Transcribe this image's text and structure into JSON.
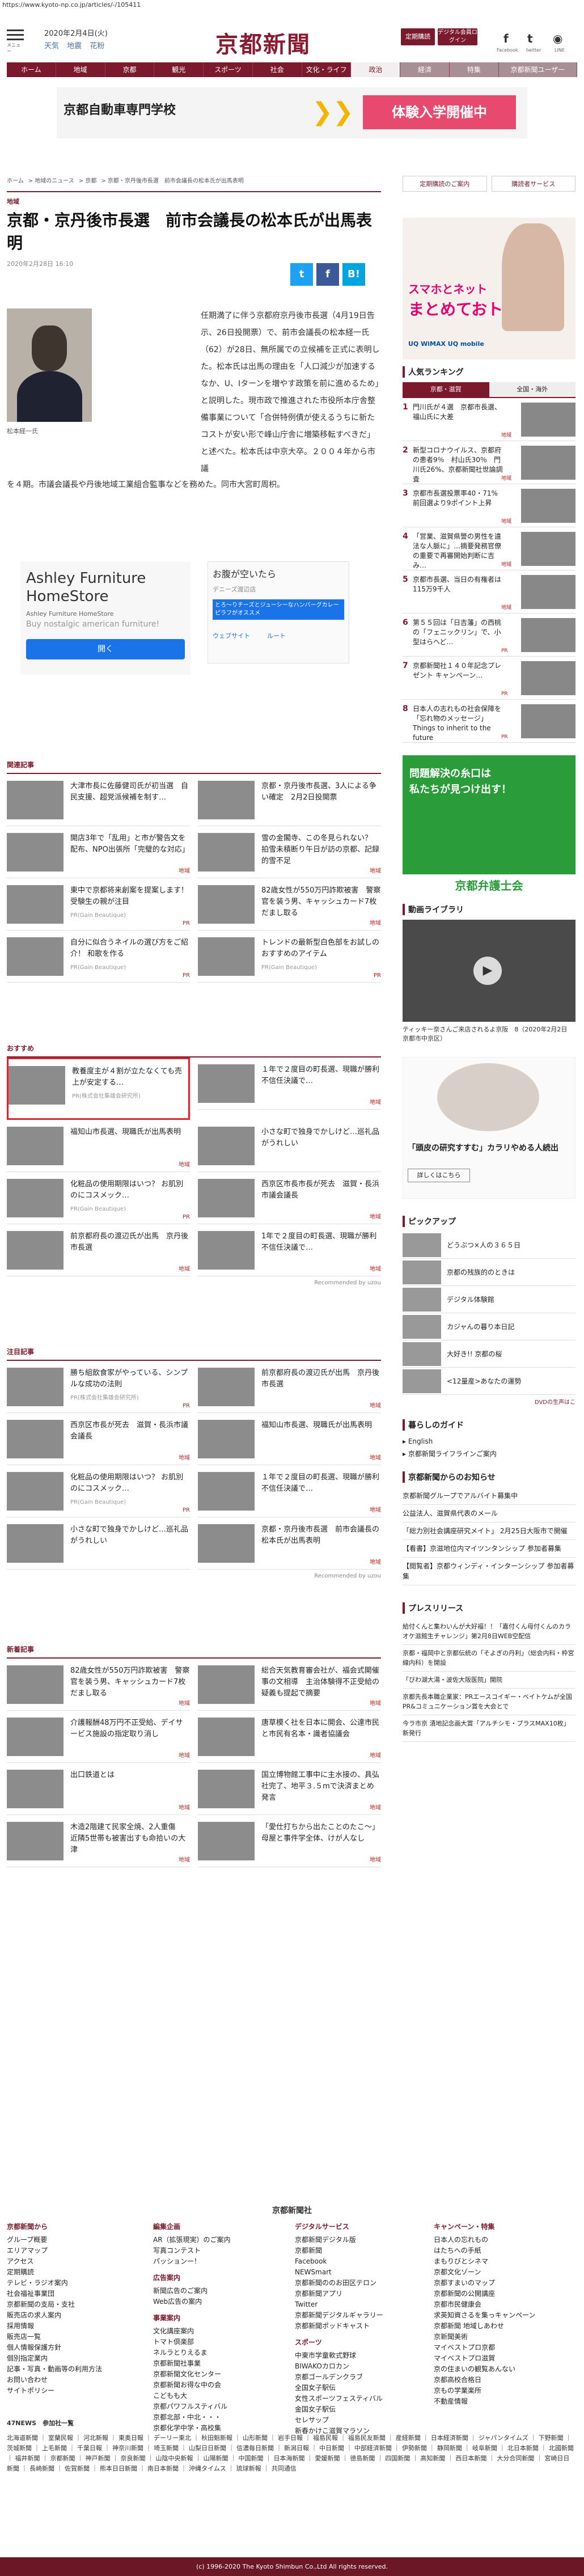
{
  "browser": {
    "url": "https://www.kyoto-np.co.jp/articles/-/105411"
  },
  "header": {
    "menu_label": "メニュー",
    "date": "2020年2月4日(火)",
    "weather": [
      "天気",
      "地震",
      "花粉"
    ],
    "logo": "京都新聞",
    "buttons": [
      "定期購読",
      "デジタル会員ログイン"
    ],
    "sns": [
      {
        "icon": "f",
        "label": "Facebook"
      },
      {
        "icon": "t",
        "label": "twitter"
      },
      {
        "icon": "◉",
        "label": "LINE"
      }
    ]
  },
  "nav": [
    "ホーム",
    "地域",
    "京都",
    "観光",
    "スポーツ",
    "社会",
    "文化・ライフ",
    "政治",
    "経済",
    "特集",
    "京都新聞ユーザー"
  ],
  "ad_top": {
    "left": "京都自動車専門学校",
    "right": "体験入学開催中"
  },
  "breadcrumb": [
    "ホーム",
    "地域のニュース",
    "京都",
    "京都・京丹後市長選　前市会議長の松本氏が出馬表明"
  ],
  "article": {
    "category": "地域",
    "title": "京都・京丹後市長選　前市会議長の松本氏が出馬表明",
    "date": "2020年2月28日 16:10",
    "photo_caption": "松本経一氏",
    "body_right": "任期満了に伴う京都府京丹後市長選（4月19日告示、26日投開票）で、前市会議長の松本経一氏（62）が28日、無所属での立候補を正式に表明した。松本氏は出馬の理由を「人口減少が加速するなか、U、Iターンを増やす政策を前に進めるため」と説明した。現市政で推進された市役所本庁舎整備事業について「合併特例債が使えるうちに新たコストが安い形で峰山庁舎に増築移転すべきだ」と述べた。松本氏は中京大卒。２００４年から市議",
    "body_bottom": "を４期。市議会議長や丹後地域工業組合監事などを務めた。同市大宮町周枳。"
  },
  "share": {
    "twitter": "t",
    "facebook": "f",
    "hatena": "B!"
  },
  "ad_mid": {
    "a_title": "Ashley Furniture HomeStore",
    "a_sub": "Ashley Furniture HomeStore",
    "a_desc": "Buy nostalgic american furniture!",
    "a_btn": "開く",
    "b_title": "お腹が空いたら",
    "b_sub": "デニーズ渡辺店",
    "b_desc": "とろ～りチーズとジューシーなハンバーグカレーピラフがオススメ",
    "b_link1": "ウェブサイト",
    "b_link2": "ルート"
  },
  "related": {
    "heading": "関連記事",
    "items": [
      {
        "text": "大津市長に佐藤健司氏が初当選　自民支援、超党派候補を制す…",
        "pr": "",
        "sp": ""
      },
      {
        "text": "京都・京丹後市長選、3人による争い確定　2月2日投開票",
        "pr": "",
        "sp": ""
      },
      {
        "text": "開店3年で「乱用」と市が警告文を配布、NPO出張所「完璧的な対応」",
        "pr": "地域",
        "sp": ""
      },
      {
        "text": "雪の金閣寺、この冬見られない？　拍雪未積断り午日が訪の京都、記録的雪不足",
        "pr": "地域",
        "sp": ""
      },
      {
        "text": "東中で京都将来創案を提案します！　受験生の親が注目",
        "pr": "PR",
        "sp": "PR(Gain Beautique)"
      },
      {
        "text": "82歳女性が550万円詐欺被害　警察官を装う男、キャッシュカード7枚だまし取る",
        "pr": "地域",
        "sp": ""
      },
      {
        "text": "自分に似合うネイルの選び方をご紹介！ 和歌を作る",
        "pr": "PR",
        "sp": "PR(Gain Beautique)"
      },
      {
        "text": "トレンドの最新型白色部をお試しのおすすめのアイテム",
        "pr": "PR",
        "sp": "PR(Gain Beautique)"
      }
    ]
  },
  "recommend": {
    "heading": "おすすめ",
    "items": [
      {
        "text": "教養度主が４割が立たなくても売上が安定する…",
        "pr": "",
        "sp": "PR(株式会社集雄会研究所)"
      },
      {
        "text": "１年で２度目の町長選、現職が勝利　不信任決議で…",
        "pr": "地域",
        "sp": ""
      },
      {
        "text": "福知山市長選、現職氏が出馬表明",
        "pr": "地域",
        "sp": ""
      },
      {
        "text": "小さな町で独身でかしけど…巡礼品がうれしい",
        "pr": "",
        "sp": ""
      },
      {
        "text": "化粧品の使用期限はいつ？ お肌別のにコスメック…",
        "pr": "PR",
        "sp": "PR(Gain Beautique)"
      },
      {
        "text": "西京区市長市長が死去　滋賀・長浜市議会議長",
        "pr": "地域",
        "sp": ""
      },
      {
        "text": "前京都府長の渡辺氏が出馬　京丹後市長選",
        "pr": "地域",
        "sp": ""
      },
      {
        "text": "1年で２度目の町長選、現職が勝利　不信任決議で…",
        "pr": "地域",
        "sp": ""
      }
    ],
    "credit": "Recommended by uzou"
  },
  "noted": {
    "heading": "注目記事",
    "items": [
      {
        "text": "勝ち組飲食家がやっている、シンプルな成功の法則",
        "pr": "PR",
        "sp": "PR(株式会社集雄会研究所)"
      },
      {
        "text": "前京都府長の渡辺氏が出馬　京丹後市長選",
        "pr": "地域",
        "sp": ""
      },
      {
        "text": "西京区市長が死去　滋賀・長浜市議会議長",
        "pr": "地域",
        "sp": ""
      },
      {
        "text": "福知山市長選、現職氏が出馬表明",
        "pr": "地域",
        "sp": ""
      },
      {
        "text": "化粧品の使用期限はいつ？ お肌別のにコスメック…",
        "pr": "PR",
        "sp": "PR(Gain Beautique)"
      },
      {
        "text": "１年で２度目の町長選、現職が勝利　不信任決議で…",
        "pr": "地域",
        "sp": ""
      },
      {
        "text": "小さな町で独身でかしけど…巡礼品がうれしい",
        "pr": "",
        "sp": ""
      },
      {
        "text": "京都・京丹後市長選　前市会議長の松本氏が出馬表明",
        "pr": "地域",
        "sp": ""
      }
    ],
    "credit": "Recommended by uzou"
  },
  "latest": {
    "heading": "新着記事",
    "items": [
      {
        "text": "82歳女性が550万円詐欺被害　警察官を装う男、キャッシュカード7枚だまし取る",
        "pr": "地域",
        "sp": ""
      },
      {
        "text": "総合天気教育審会社が、福会式開催事の文相導　主治体験得不正受給の疑義も提起で摘要",
        "pr": "地域",
        "sp": ""
      },
      {
        "text": "介護報酬48万円不正受給、デイサービス施設の指定取り消し",
        "pr": "地域",
        "sp": ""
      },
      {
        "text": "唐草模く社を日本に開会、公達市民と市民有名本・識者協議会",
        "pr": "地域",
        "sp": ""
      },
      {
        "text": "出口鉄道とは",
        "pr": "地域",
        "sp": ""
      },
      {
        "text": "国立博物館工事中に主水接の、具弘社完了、地平３.５mで決済まとめ発言",
        "pr": "地域",
        "sp": ""
      },
      {
        "text": "木造2階建て民家全焼、2人重傷　近隣5世帯も被害出すも命拾いの大津",
        "pr": "地域",
        "sp": ""
      },
      {
        "text": "「愛仕打ちから出たことのたこ～」　母屋と事件学全体、けが人なし",
        "pr": "地域",
        "sp": ""
      }
    ]
  },
  "sidebar": {
    "links": [
      "定期購読のご案内",
      "購読者サービス"
    ],
    "ad_banner": {
      "line1": "スマホとネット",
      "line2": "まとめておトク",
      "line3": "UQ WiMAX  UQ mobile"
    },
    "ranking": {
      "heading": "人気ランキング",
      "tabs": [
        "京都・滋賀",
        "全国・海外"
      ],
      "items": [
        {
          "n": "1",
          "text": "門川氏が４選　京都市長選、福山氏に大差",
          "pr": "地域"
        },
        {
          "n": "2",
          "text": "新型コロナウイルス、京都府の患者9％　村山氏30％　門川氏26%、京都新聞社世論調査",
          "pr": "地域"
        },
        {
          "n": "3",
          "text": "京都市長選投票率40・71%　前回選より9ポイント上昇",
          "pr": "地域"
        },
        {
          "n": "4",
          "text": "「営業、滋賀県警の男性を違法な人脈に」…摘要発務官僚の重要で再審開始判断に吉み…",
          "pr": "地域"
        },
        {
          "n": "5",
          "text": "京都市長選、当日の有権者は115万9千人",
          "pr": "地域"
        },
        {
          "n": "6",
          "text": "第５５回は「日吉藩」の西桃の「フェニックリン」で、小型はらへど…",
          "pr": "PR"
        },
        {
          "n": "7",
          "text": "京都新聞社１４０年記念プレゼント キャンペーン…",
          "pr": "PR"
        },
        {
          "n": "8",
          "text": "日本人の志れもの社会保障を　「忘れ物のメッセージ」Things to inherit to the future",
          "pr": "PR"
        }
      ]
    },
    "ad_green": {
      "line1": "問題解決の糸口は",
      "line2": "私たちが見つけ出す！",
      "footer": "京都弁護士会"
    },
    "video": {
      "heading": "動画ライブラリ",
      "caption": "ティッキー奈さんご来店されるよ京阪　8（2020年2月2日　京都市中京区）"
    },
    "ad_book": {
      "title": "「頭皮の研究すすむ」カラリやめる人続出",
      "btn": "詳しくはこちら"
    },
    "pickup": {
      "heading": "ピックアップ",
      "items": [
        "どうぶつ×人の３６５日",
        "京都の残族的のときは",
        "デジタル体験館",
        "カジャんの暮り本日記",
        "大好き!! 京都の桜",
        "<12量産>あなたの運勢"
      ],
      "more": "DVDの生声はこ"
    },
    "guide": {
      "heading": "暮らしのガイド",
      "items": [
        "English",
        "京都新聞ライフラインご案内"
      ]
    },
    "notice": {
      "heading": "京都新聞からのお知らせ",
      "items": [
        "京都新聞グループでアルバイト募集中",
        "公益法人、滋賀県代表のメール",
        "「総力別社会講座研究メイト」 2月25日大阪市で開催",
        "【看書】京滋地位内マイツンタンシップ 参加者募集",
        "【閲覧者】京都ウィンディ・インターンシップ 参加者募集"
      ]
    },
    "press": {
      "heading": "プレスリリース",
      "items": [
        "給付くんと集わいんが大好福！！「嘉付くん母付くんのカラオケ滋館生チャレンジ」第2月8日WEB空配信",
        "京都・福岡中と京都伝統の「そよぎの丹利」（総会内科・枠宮線内科）を開設",
        "「びわ湖大湯・波佐大阪医院」開院",
        "京都先長本職企業家：PRエースコイギー・ベイトケムが全国PR&コミュニケーション賞を大会とで",
        "今ラ市京 漬地記念画大賞「アルチシモ・プラスMAX10枚」新発行"
      ]
    }
  },
  "footer": {
    "logo": "京都新聞社",
    "cols": [
      {
        "head": "京都新聞から",
        "items": [
          "グループ概要",
          "エリアマップ",
          "アクセス",
          "定期購読",
          "テレビ・ラジオ案内",
          "社会福祉事業団",
          "京都新聞の支局・支社",
          "販売店の求人案内",
          "採用情報",
          "販売店一覧",
          "個人情報保護方針",
          "個別指定業内",
          "記事・写真・動画等の利用方法",
          "お問い合わせ",
          "サイトポリシー"
        ]
      },
      {
        "head": "編集企画",
        "items": [
          "AR（拡張現実）のご案内",
          "写真コンテスト",
          "パッションー！"
        ],
        "head2": "広告案内",
        "items2": [
          "新聞広告のご案内",
          "Web広告の案内"
        ],
        "head3": "事業案内",
        "items3": [
          "文化講座案内",
          "トマト倶楽部",
          "ネルラとりえるま",
          "京都新聞社事業",
          "京都新聞文化センター",
          "京都新聞お得な中の会",
          "こどもも大",
          "京都パワフルスティバル",
          "京都北部・中北・・・",
          "京都化学中学・高校集"
        ]
      },
      {
        "head": "デジタルサービス",
        "items": [
          "京都新聞デジタル版",
          "京都新聞",
          "Facebook",
          "NEWSmart",
          "京都新聞ののお田区テロン",
          "京都新聞アプリ",
          "Twitter",
          "京都新聞デジタルギャラリー",
          "京都新聞ポッドキャスト"
        ],
        "head2": "スポーツ",
        "items2": [
          "中東市学童軟式野球",
          "BIWAKOカロカン",
          "京都ゴールデンクラブ",
          "全国女子駅伝",
          "女性スポーツフェスティバル",
          "金国女子駅伝",
          "セレサップ",
          "新春かけこ滋賀マラソン"
        ]
      },
      {
        "head": "キャンペーン・特集",
        "items": [
          "日本人の忘れもの",
          "はたちへの手紙",
          "まもりびとシネマ",
          "京都文化ゾーン",
          "京都すまいのマップ",
          "京都新聞の公開講座",
          "京都市民健康会",
          "求英知資さるを集っキャンペーン",
          "京都新聞 地域しあわせ",
          "京新聞美術",
          "マイベストプロ京都",
          "マイベストプロ滋賀",
          "京の住まいの観覧あんない",
          "京都高校合格日",
          "京もの学業楽所",
          "不動産情報"
        ]
      }
    ],
    "link_heading": "47NEWS　参加社一覧",
    "links": "北海道新聞 ｜ 室蘭民報 ｜ 河北新報 ｜ 東奥日報 ｜ デーリー東北 ｜ 秋田魁新報 ｜ 山形新聞 ｜ 岩手日報 ｜ 福島民報 ｜ 福島民友新聞 ｜ 産経新聞 ｜ 日本経済新聞 ｜ ジャパンタイムズ ｜ 下野新聞 ｜ 茨城新聞 ｜ 上毛新聞 ｜ 千葉日報 ｜ 神奈川新聞 ｜ 埼玉新聞 ｜ 山梨日日新聞 ｜ 信濃毎日新聞 ｜ 新潟日報 ｜ 中日新聞 ｜ 中部経済新聞 ｜ 伊勢新聞 ｜ 静岡新聞 ｜ 岐阜新聞 ｜ 北日本新聞 ｜ 北國新聞 ｜ 福井新聞 ｜ 京都新聞 ｜ 神戸新聞 ｜ 奈良新聞 ｜ 山陰中央新報 ｜ 山陽新聞 ｜ 中国新聞 ｜ 日本海新聞 ｜ 愛媛新聞 ｜ 徳島新聞 ｜ 四国新聞 ｜ 高知新聞 ｜ 西日本新聞 ｜ 大分合同新聞 ｜ 宮崎日日新聞 ｜ 長崎新聞 ｜ 佐賀新聞 ｜ 熊本日日新聞 ｜ 南日本新聞 ｜ 沖縄タイムス ｜ 琉球新報 ｜ 共同通信",
    "copyright": "(c) 1996-2020 The Kyoto Shimbun Co.,Ltd All rights reserved."
  }
}
